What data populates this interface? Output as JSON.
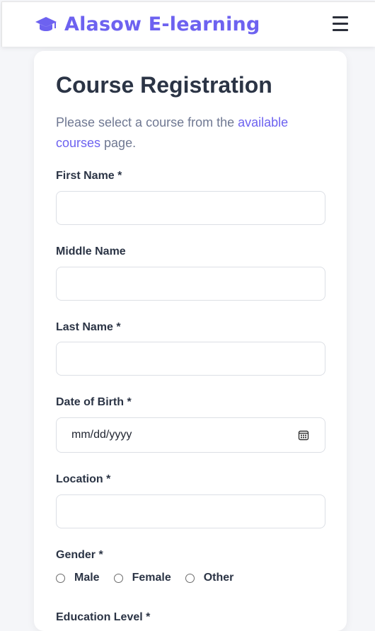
{
  "header": {
    "brand": "Alasow E-learning",
    "brand_icon": "graduation-cap-icon",
    "menu_icon": "hamburger-menu-icon",
    "accent": "#6d62f0"
  },
  "form": {
    "title": "Course Registration",
    "intro_before": "Please select a course from the ",
    "intro_link": "available courses",
    "intro_after": " page.",
    "first_name_label": "First Name *",
    "middle_name_label": "Middle Name",
    "last_name_label": "Last Name *",
    "dob_label": "Date of Birth *",
    "dob_placeholder": "mm/dd/yyyy",
    "location_label": "Location *",
    "gender_label": "Gender *",
    "gender_options": [
      "Male",
      "Female",
      "Other"
    ],
    "education_label": "Education Level *"
  }
}
